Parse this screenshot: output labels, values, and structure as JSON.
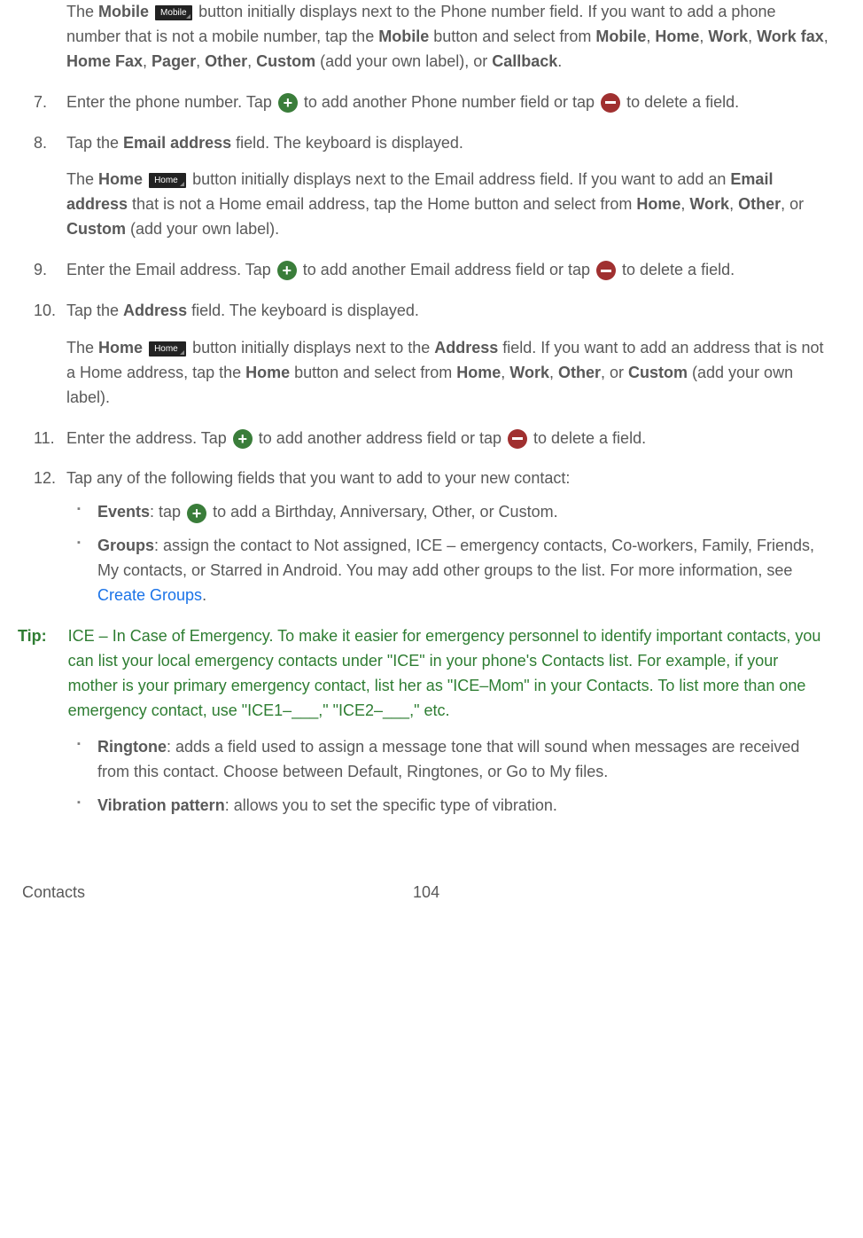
{
  "icons": {
    "mobile_button": "Mobile",
    "home_button": "Home"
  },
  "content": {
    "p_mobile_intro_1": "The ",
    "p_mobile_intro_bold": "Mobile",
    "p_mobile_intro_2": " button initially displays next to the Phone number field. If you want to add a phone number that is not a mobile number, tap the ",
    "p_mobile_intro_3": " button and select from ",
    "p_mobile_intro_4": " (add your own label), or ",
    "p_mobile_intro_5": ".",
    "mobile_options": [
      "Mobile",
      "Home",
      "Work",
      "Work fax",
      "Home Fax",
      "Pager",
      "Other",
      "Custom",
      "Callback"
    ],
    "step7_num": "7.",
    "step7_a": "Enter the phone number. Tap ",
    "step7_b": " to add another Phone number field or tap ",
    "step7_c": " to delete a field.",
    "step8_num": "8.",
    "step8_a": "Tap the ",
    "step8_bold": "Email address",
    "step8_b": " field. The keyboard is displayed.",
    "step8_body_a": "The ",
    "step8_body_home": "Home",
    "step8_body_b": " button initially displays next to the Email address field. If you want to add an ",
    "step8_body_c": " that is not a Home email address, tap the Home button and select from ",
    "step8_body_d": " (add your own label).",
    "email_options": [
      "Home",
      "Work",
      "Other",
      "Custom"
    ],
    "step9_num": "9.",
    "step9_a": "Enter the Email address. Tap ",
    "step9_b": " to add another Email address field or tap ",
    "step9_c": " to delete a field.",
    "step10_num": "10.",
    "step10_a": "Tap the ",
    "step10_bold": "Address",
    "step10_b": " field. The keyboard is displayed.",
    "step10_body_a": "The ",
    "step10_body_b": " button initially displays next to the ",
    "step10_body_c": " field. If you want to add an address that is not a Home address, tap the ",
    "step10_body_d": " button and select from ",
    "step10_body_e": " (add your own label).",
    "addr_options": [
      "Home",
      "Work",
      "Other",
      "Custom"
    ],
    "step11_num": "11.",
    "step11_a": "Enter the address. Tap ",
    "step11_b": " to add another address field or tap ",
    "step11_c": " to delete a field.",
    "step12_num": "12.",
    "step12_a": "Tap any of the following fields that you want to add to your new contact:",
    "bullet_events_label": "Events",
    "bullet_events_a": ": tap ",
    "bullet_events_b": " to add a Birthday, Anniversary, Other, or Custom.",
    "bullet_groups_label": "Groups",
    "bullet_groups_a": ": assign the contact to Not assigned, ICE – emergency contacts, Co-workers, Family, Friends, My contacts, or Starred in Android. You may add other groups to the list. For more information, see ",
    "bullet_groups_link": "Create Groups",
    "bullet_groups_b": ".",
    "tip_label": "Tip:",
    "tip_body": "ICE – In Case of Emergency. To make it easier for emergency personnel to identify important contacts, you can list your local emergency contacts under \"ICE\" in your phone's Contacts list. For example, if your mother is your primary emergency contact, list her as \"ICE–Mom\" in your Contacts. To list more than one emergency contact, use \"ICE1–___,\" \"ICE2–___,\" etc.",
    "bullet_ringtone_label": "Ringtone",
    "bullet_ringtone_text": ": adds a field used to assign a message tone that will sound when messages are received from this contact. Choose between Default, Ringtones, or Go to My files.",
    "bullet_vibration_label": "Vibration pattern",
    "bullet_vibration_text": ": allows you to set the specific type of vibration."
  },
  "footer": {
    "section": "Contacts",
    "page": "104"
  }
}
